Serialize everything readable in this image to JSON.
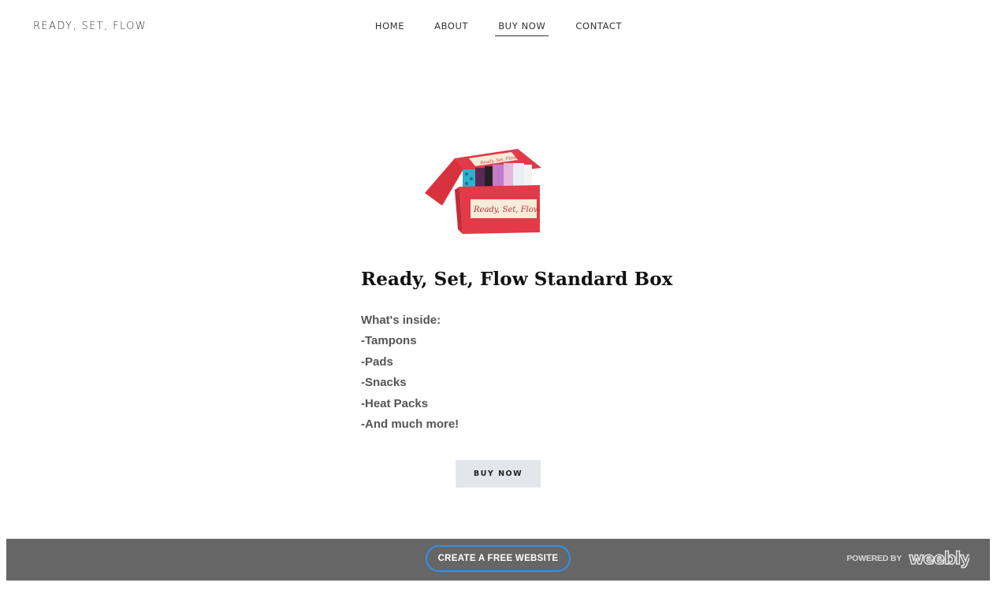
{
  "site": {
    "title": "READY, SET, FLOW"
  },
  "nav": {
    "items": [
      {
        "label": "HOME",
        "active": false
      },
      {
        "label": "ABOUT",
        "active": false
      },
      {
        "label": "BUY NOW",
        "active": true
      },
      {
        "label": "CONTACT",
        "active": false
      }
    ]
  },
  "product": {
    "image_label": "Ready, Set, Flow",
    "title": "Ready, Set, Flow Standard Box",
    "details": [
      "What's inside:",
      "-Tampons",
      "-Pads",
      "-Snacks",
      "-Heat Packs",
      "-And much more!"
    ],
    "buy_label": "BUY NOW"
  },
  "footer": {
    "create_label": "CREATE A FREE WEBSITE",
    "powered_label": "POWERED BY",
    "logo_text": "weebly",
    "background": "#666666",
    "button_border": "#2f8ff0"
  },
  "colors": {
    "box_red": "#e23a48",
    "label_cream": "#f6ecd7",
    "button_bg": "#e3e6ea"
  }
}
